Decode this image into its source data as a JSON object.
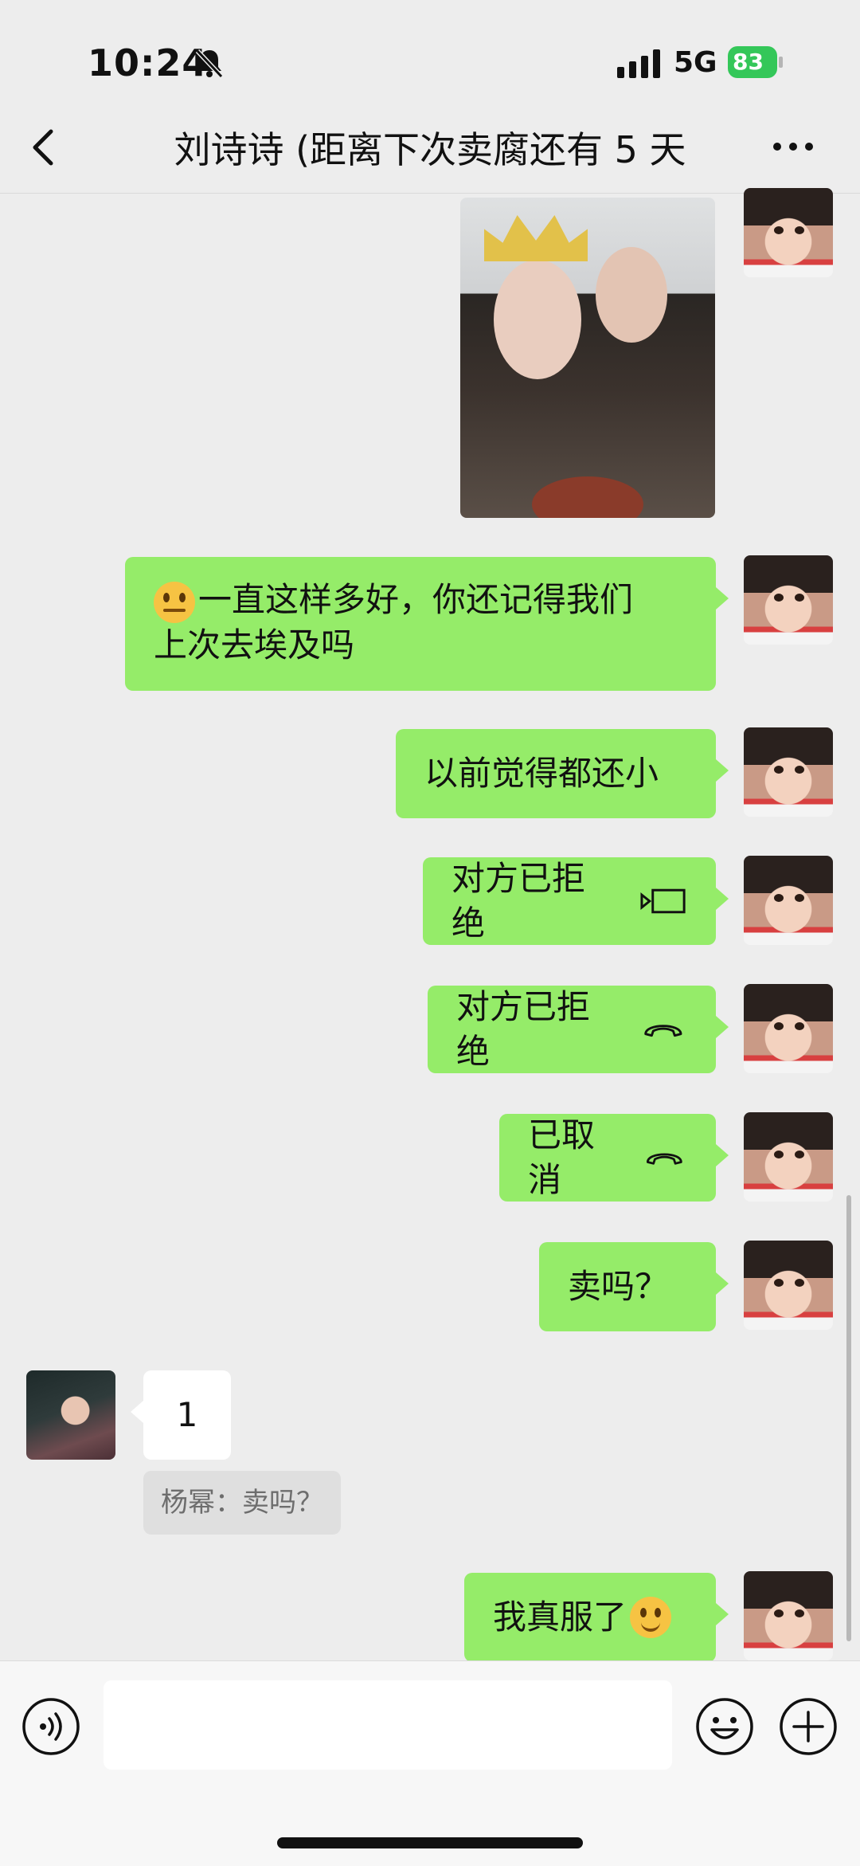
{
  "status_bar": {
    "time": "10:24",
    "network": "5G",
    "battery": "83",
    "icons": [
      "bell-slash-icon",
      "signal-icon",
      "battery-charging-icon"
    ]
  },
  "header": {
    "title": "刘诗诗 (距离下次卖腐还有 5 天",
    "back_icon": "chevron-left-icon",
    "more_icon": "more-dots-icon"
  },
  "messages": [
    {
      "side": "right",
      "type": "image"
    },
    {
      "side": "right",
      "type": "text",
      "line1": "一直这样多好，你还记得我们",
      "line2": "上次去埃及吗",
      "emoji": "expressionless-face"
    },
    {
      "side": "right",
      "type": "text",
      "text": "以前觉得都还小"
    },
    {
      "side": "right",
      "type": "call",
      "text": "对方已拒绝",
      "icon": "video-call-icon"
    },
    {
      "side": "right",
      "type": "call",
      "text": "对方已拒绝",
      "icon": "phone-hangup-icon"
    },
    {
      "side": "right",
      "type": "call",
      "text": "已取消",
      "icon": "phone-hangup-icon"
    },
    {
      "side": "right",
      "type": "text",
      "text": "卖吗？"
    },
    {
      "side": "left",
      "type": "text",
      "text": "1",
      "quote": "杨幂：卖吗？"
    },
    {
      "side": "right",
      "type": "text",
      "text": "我真服了",
      "emoji": "smiling-face"
    }
  ],
  "input_bar": {
    "placeholder": "",
    "icons": [
      "voice-icon",
      "emoji-icon",
      "plus-icon"
    ]
  },
  "colors": {
    "background": "#ededed",
    "outgoing_bubble": "#95ec69",
    "incoming_bubble": "#ffffff",
    "battery": "#34c759"
  }
}
